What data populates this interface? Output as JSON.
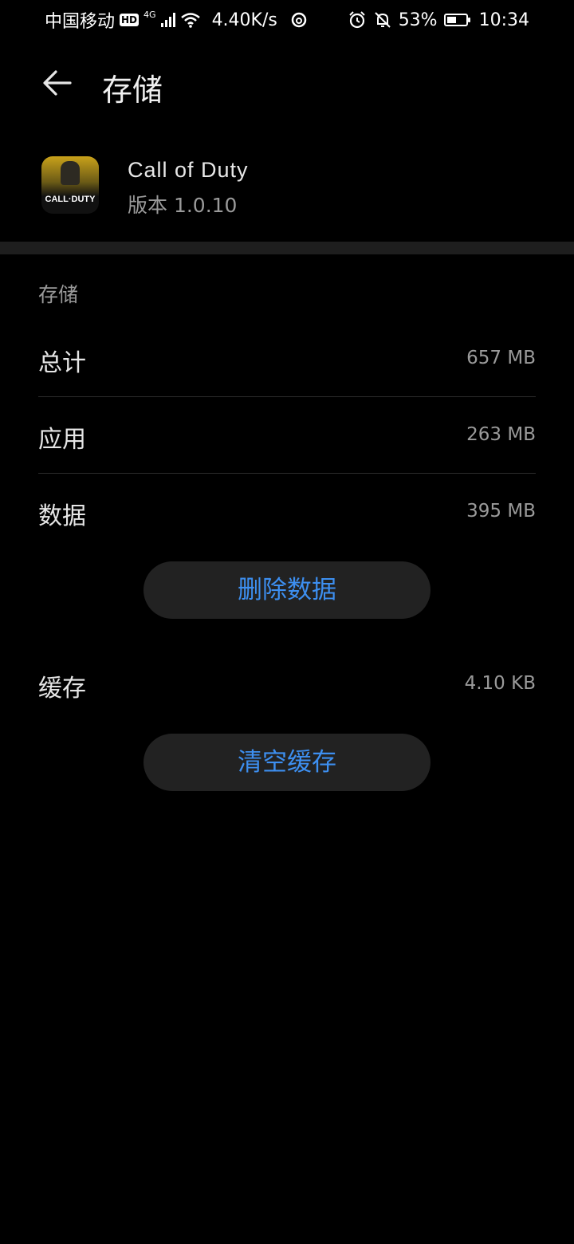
{
  "status_bar": {
    "carrier": "中国移动",
    "hd_badge": "HD",
    "network_type": "4G",
    "speed": "4.40K/s",
    "battery_percent": "53%",
    "battery_level": 0.53,
    "time": "10:34"
  },
  "app_bar": {
    "back_icon": "arrow-left-icon",
    "title": "存储"
  },
  "app": {
    "name": "Call of Duty",
    "version": "版本 1.0.10",
    "icon_logo_text": "CALL·DUTY"
  },
  "storage": {
    "section_title": "存储",
    "rows": [
      {
        "label": "总计",
        "value": "657 MB"
      },
      {
        "label": "应用",
        "value": "263 MB"
      },
      {
        "label": "数据",
        "value": "395 MB"
      }
    ],
    "clear_data_button": "删除数据",
    "cache": {
      "label": "缓存",
      "value": "4.10 KB"
    },
    "clear_cache_button": "清空缓存"
  },
  "colors": {
    "background": "#000000",
    "accent": "#3d8ff0",
    "button_bg": "#222222"
  }
}
